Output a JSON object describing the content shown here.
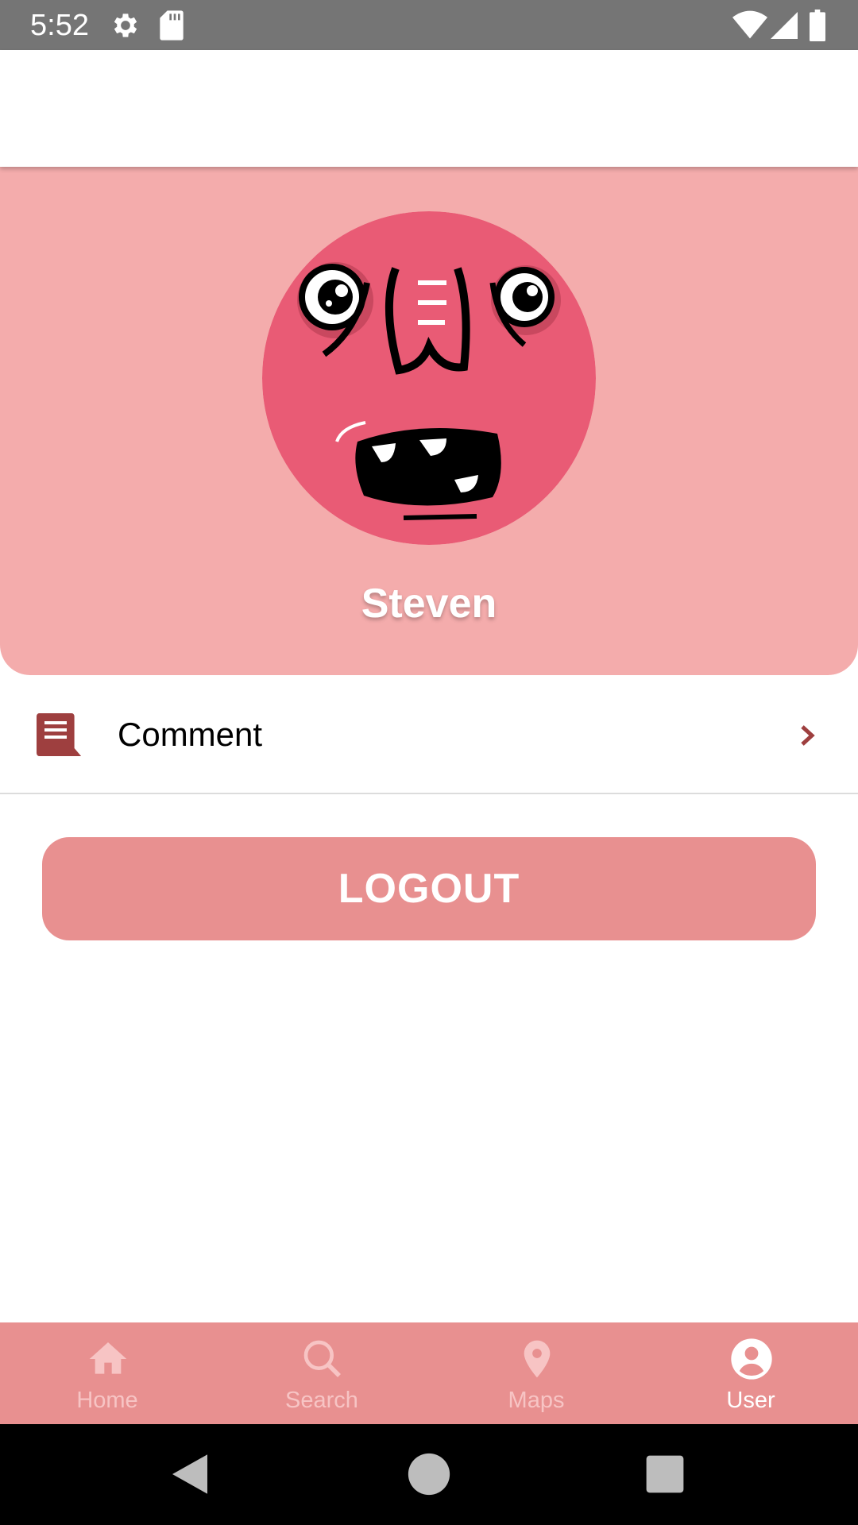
{
  "status_bar": {
    "time": "5:52"
  },
  "profile": {
    "name": "Steven"
  },
  "menu": {
    "comment_label": "Comment"
  },
  "logout": {
    "label": "LOGOUT"
  },
  "bottom_nav": {
    "items": [
      {
        "label": "Home",
        "icon": "home-icon",
        "active": false
      },
      {
        "label": "Search",
        "icon": "search-icon",
        "active": false
      },
      {
        "label": "Maps",
        "icon": "map-pin-icon",
        "active": false
      },
      {
        "label": "User",
        "icon": "user-icon",
        "active": true
      }
    ]
  },
  "colors": {
    "accent": "#e89090",
    "card_background": "#f4acac",
    "avatar_face": "#e95b75",
    "icon_dark": "#9e3f3f",
    "status_bar": "#757575"
  }
}
